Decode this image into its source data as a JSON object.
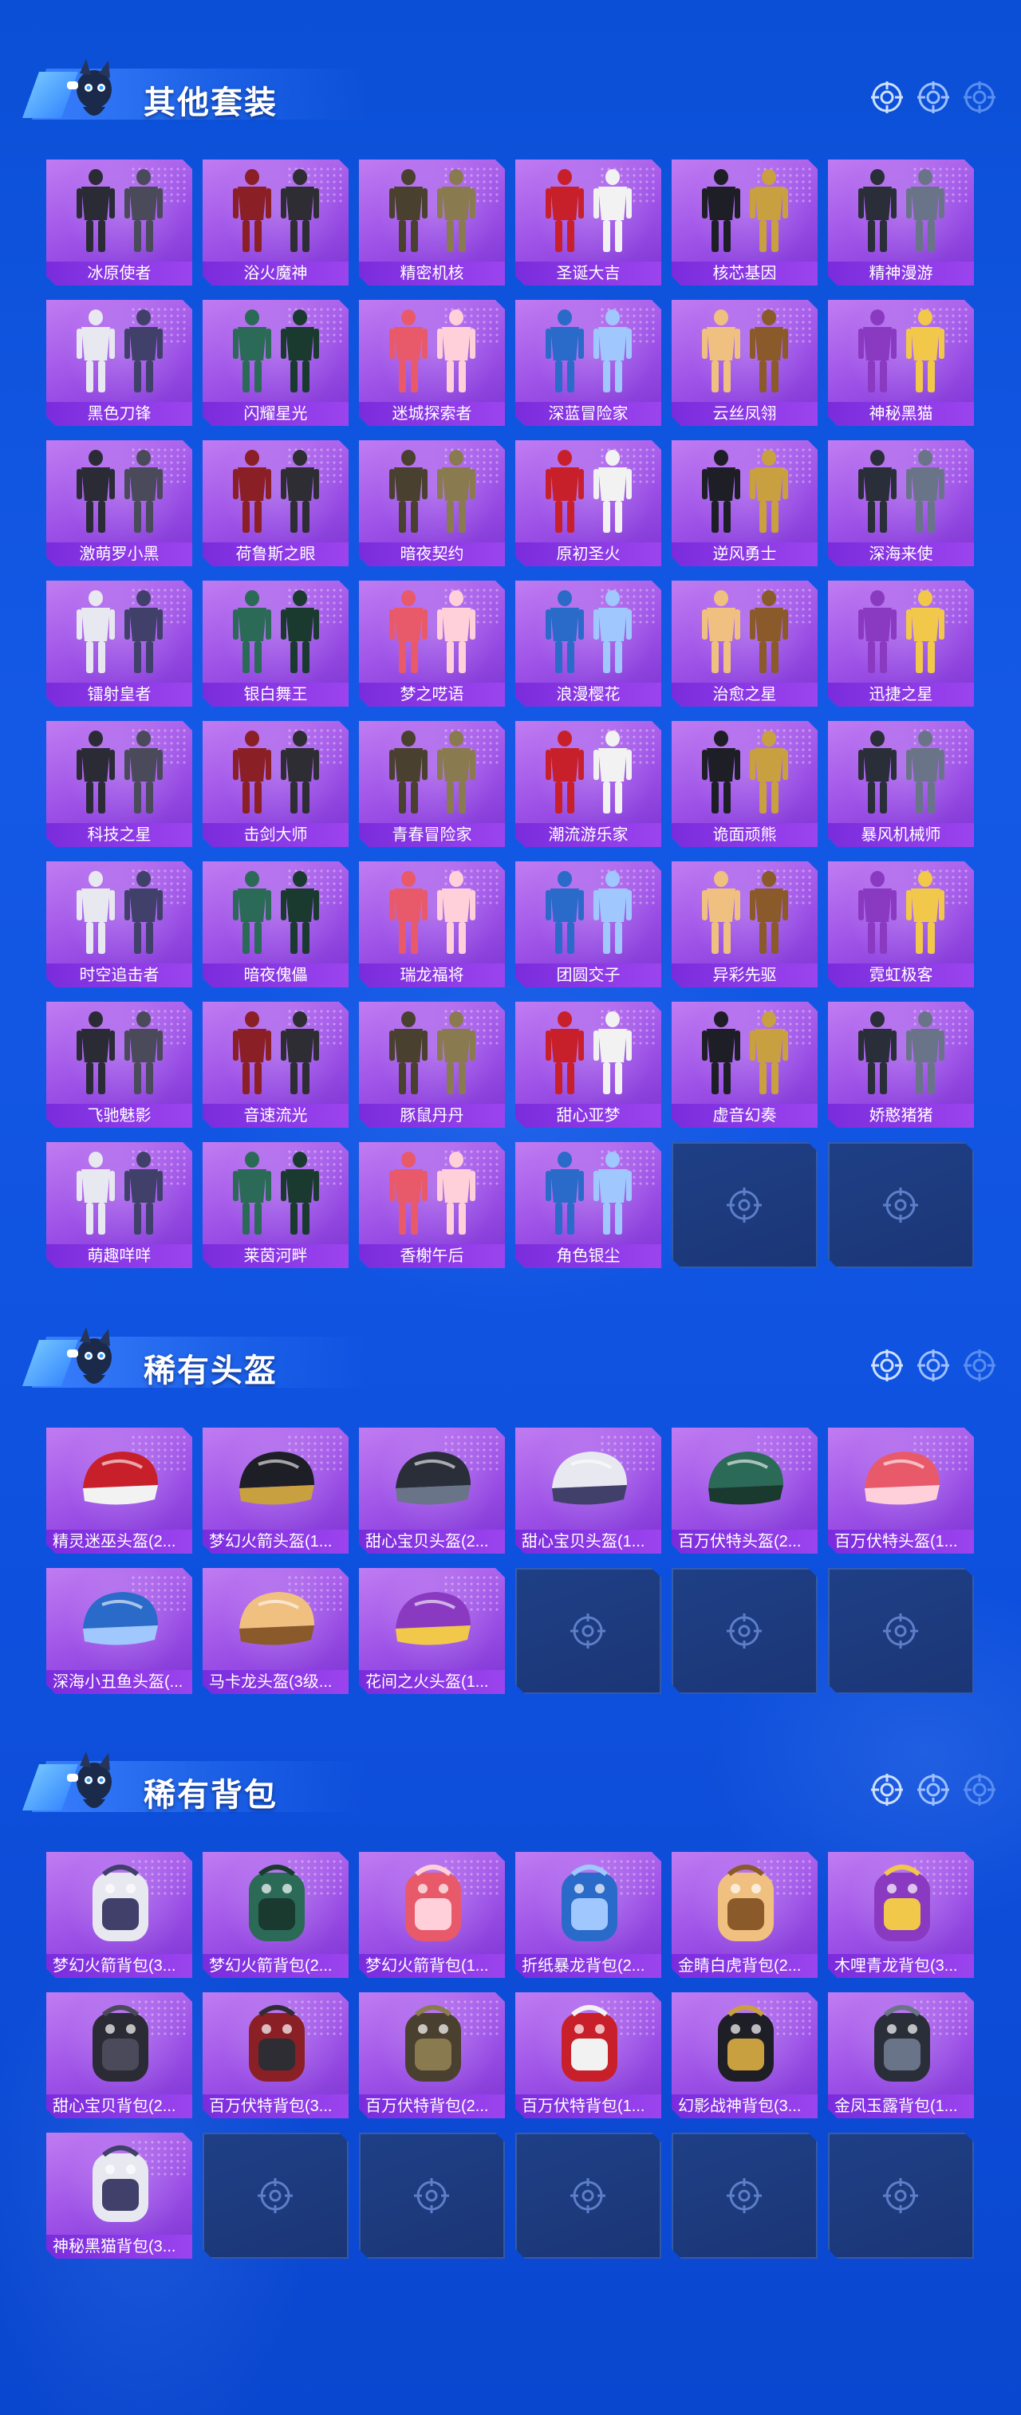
{
  "colors": {
    "background": "#0f52e0",
    "card_purple": "#9b4fe6",
    "label_bar": "#7a2cdc",
    "empty_slot": "#1f3f86"
  },
  "sections": [
    {
      "title": "其他套装",
      "items": [
        "冰原使者",
        "浴火魔神",
        "精密机核",
        "圣诞大吉",
        "核芯基因",
        "精神漫游",
        "黑色刀锋",
        "闪耀星光",
        "迷城探索者",
        "深蓝冒险家",
        "云丝凤翎",
        "神秘黑猫",
        "激萌罗小黑",
        "荷鲁斯之眼",
        "暗夜契约",
        "原初圣火",
        "逆风勇士",
        "深海来使",
        "镭射皇者",
        "银白舞王",
        "梦之呓语",
        "浪漫樱花",
        "治愈之星",
        "迅捷之星",
        "科技之星",
        "击剑大师",
        "青春冒险家",
        "潮流游乐家",
        "诡面顽熊",
        "暴风机械师",
        "时空追击者",
        "暗夜傀儡",
        "瑞龙福将",
        "团圆交子",
        "异彩先驱",
        "霓虹极客",
        "飞驰魅影",
        "音速流光",
        "豚鼠丹丹",
        "甜心亚梦",
        "虚音幻奏",
        "娇憨猪猪",
        "萌趣咩咩",
        "莱茵河畔",
        "香榭午后",
        "角色银尘"
      ],
      "empty_slots": 2
    },
    {
      "title": "稀有头盔",
      "items": [
        "精灵迷巫头盔(2...",
        "梦幻火箭头盔(1...",
        "甜心宝贝头盔(2...",
        "甜心宝贝头盔(1...",
        "百万伏特头盔(2...",
        "百万伏特头盔(1...",
        "深海小丑鱼头盔(...",
        "马卡龙头盔(3级...",
        "花间之火头盔(1..."
      ],
      "empty_slots": 3
    },
    {
      "title": "稀有背包",
      "items": [
        "梦幻火箭背包(3...",
        "梦幻火箭背包(2...",
        "梦幻火箭背包(1...",
        "折纸暴龙背包(2...",
        "金睛白虎背包(2...",
        "木哩青龙背包(3...",
        "甜心宝贝背包(2...",
        "百万伏特背包(3...",
        "百万伏特背包(2...",
        "百万伏特背包(1...",
        "幻影战神背包(3...",
        "金凤玉露背包(1...",
        "神秘黑猫背包(3..."
      ],
      "empty_slots": 5
    }
  ]
}
